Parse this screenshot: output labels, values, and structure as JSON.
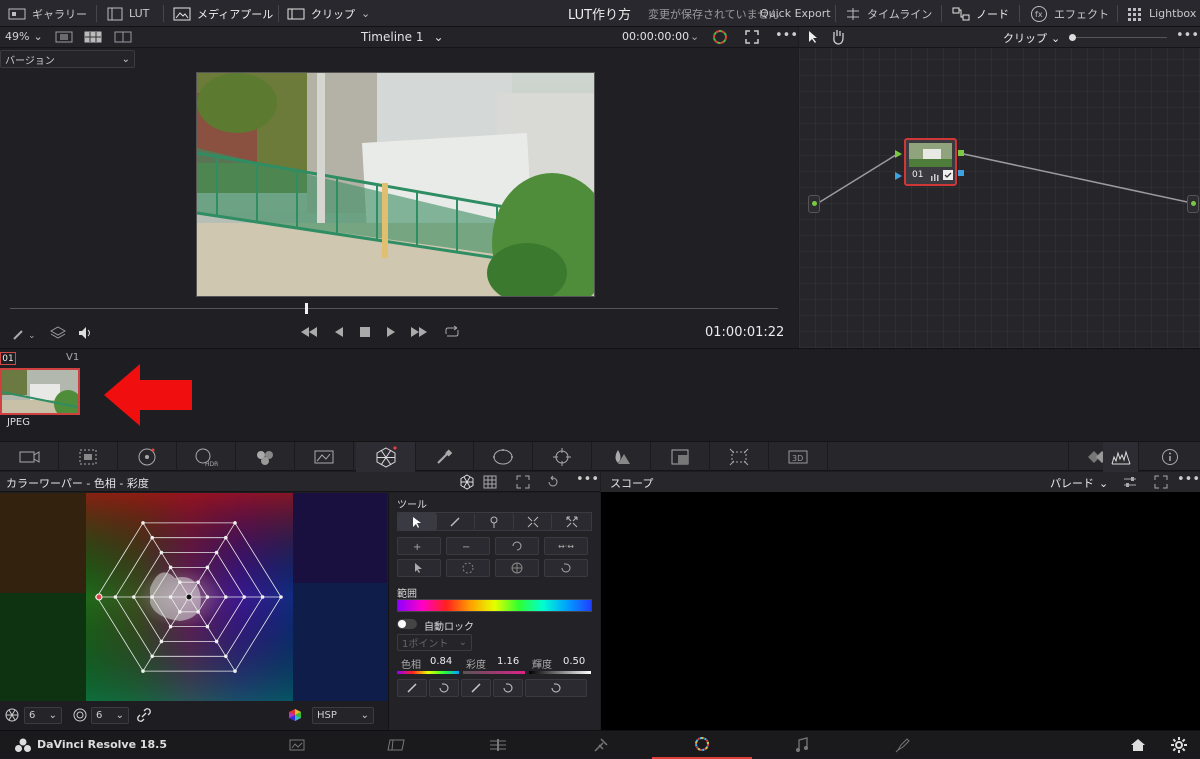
{
  "topbar": {
    "gallery": "ギャラリー",
    "lut": "LUT",
    "media_pool": "メディアプール",
    "clips": "クリップ",
    "project_title": "LUT作り方",
    "save_status": "変更が保存されていません",
    "quick_export": "Quick Export",
    "timeline": "タイムライン",
    "nodes": "ノード",
    "effects": "エフェクト",
    "lightbox": "Lightbox"
  },
  "viewer": {
    "zoom": "49%",
    "timeline_name": "Timeline 1",
    "source_timecode": "00:00:00:00",
    "version_dropdown": "バージョン",
    "timecode": "01:00:01:22",
    "scrub_position": 0.385
  },
  "node_editor": {
    "mode": "クリップ",
    "node_label": "01"
  },
  "clips": {
    "items": [
      {
        "number": "01",
        "track": "V1",
        "codec": "JPEG"
      }
    ]
  },
  "warper": {
    "title": "カラーワーパー - 色相 - 彩度",
    "hue_grid": "6",
    "sat_grid": "6",
    "color_space": "HSP",
    "tools_label": "ツール",
    "range_label": "範囲",
    "auto_lock": "自動ロック",
    "point_mode": "1ポイント",
    "hue_label": "色相",
    "hue_value": "0.84",
    "sat_label": "彩度",
    "sat_value": "1.16",
    "luma_label": "輝度",
    "luma_value": "0.50"
  },
  "scope": {
    "title": "スコープ",
    "mode": "パレード"
  },
  "bottombar": {
    "app_name": "DaVinci Resolve 18.5"
  },
  "colors": {
    "accent_red": "#e0403a",
    "node_green": "#7ac943",
    "panel_bg": "#1e1e22"
  }
}
